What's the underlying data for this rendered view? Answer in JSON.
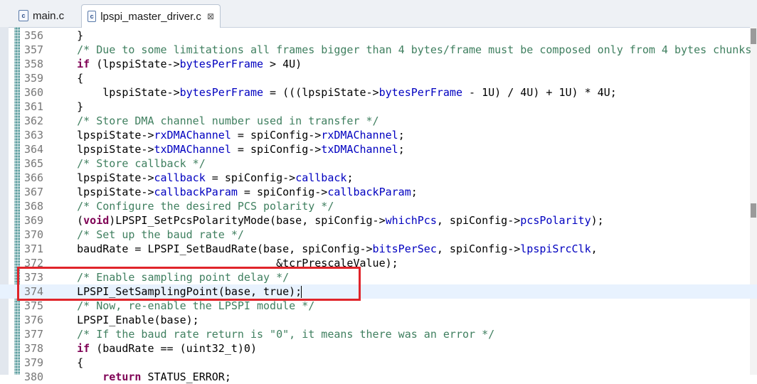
{
  "tabs": [
    {
      "label": "main.c",
      "icon": "c-file-icon",
      "active": false
    },
    {
      "label": "lpspi_master_driver.c",
      "icon": "c-file-icon",
      "active": true,
      "close": "⊠"
    }
  ],
  "editor": {
    "current_line": "374",
    "lines": [
      {
        "no": "356",
        "text": "    }"
      },
      {
        "no": "357",
        "text": "    /* Due to some limitations all frames bigger than 4 bytes/frame must be composed only from 4 bytes chunks"
      },
      {
        "no": "358",
        "text": "    if (lpspiState->bytesPerFrame > 4U)"
      },
      {
        "no": "359",
        "text": "    {"
      },
      {
        "no": "360",
        "text": "        lpspiState->bytesPerFrame = (((lpspiState->bytesPerFrame - 1U) / 4U) + 1U) * 4U;"
      },
      {
        "no": "361",
        "text": "    }"
      },
      {
        "no": "362",
        "text": "    /* Store DMA channel number used in transfer */"
      },
      {
        "no": "363",
        "text": "    lpspiState->rxDMAChannel = spiConfig->rxDMAChannel;"
      },
      {
        "no": "364",
        "text": "    lpspiState->txDMAChannel = spiConfig->txDMAChannel;"
      },
      {
        "no": "365",
        "text": "    /* Store callback */"
      },
      {
        "no": "366",
        "text": "    lpspiState->callback = spiConfig->callback;"
      },
      {
        "no": "367",
        "text": "    lpspiState->callbackParam = spiConfig->callbackParam;"
      },
      {
        "no": "368",
        "text": "    /* Configure the desired PCS polarity */"
      },
      {
        "no": "369",
        "text": "    (void)LPSPI_SetPcsPolarityMode(base, spiConfig->whichPcs, spiConfig->pcsPolarity);"
      },
      {
        "no": "370",
        "text": "    /* Set up the baud rate */"
      },
      {
        "no": "371",
        "text": "    baudRate = LPSPI_SetBaudRate(base, spiConfig->bitsPerSec, spiConfig->lpspiSrcClk,"
      },
      {
        "no": "372",
        "text": "                                   &tcrPrescaleValue);"
      },
      {
        "no": "373",
        "text": "    /* Enable sampling point delay */"
      },
      {
        "no": "374",
        "text": "    LPSPI_SetSamplingPoint(base, true);"
      },
      {
        "no": "375",
        "text": "    /* Now, re-enable the LPSPI module */"
      },
      {
        "no": "376",
        "text": "    LPSPI_Enable(base);"
      },
      {
        "no": "377",
        "text": "    /* If the baud rate return is \"0\", it means there was an error */"
      },
      {
        "no": "378",
        "text": "    if (baudRate == (uint32_t)0)"
      },
      {
        "no": "379",
        "text": "    {"
      },
      {
        "no": "380",
        "text": "        return STATUS_ERROR;"
      }
    ]
  },
  "colors": {
    "keyword": "#7f0055",
    "comment": "#3f7f5f",
    "field": "#0000c0",
    "highlight_box": "#e0242a",
    "current_line": "#e8f2fe"
  }
}
